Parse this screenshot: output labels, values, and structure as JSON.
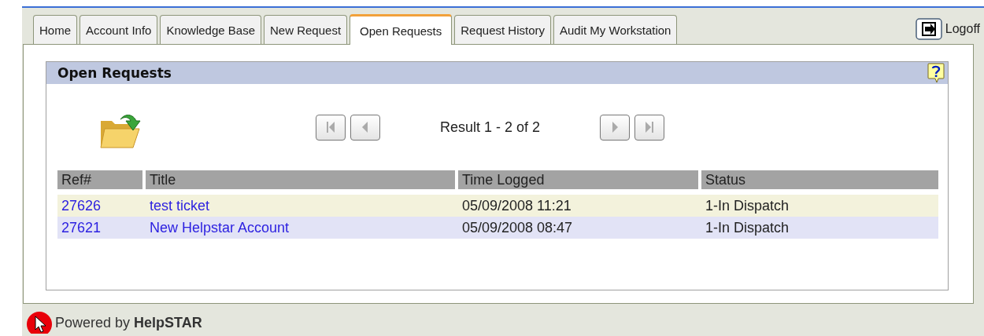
{
  "tabs": [
    {
      "label": "Home",
      "selected": false
    },
    {
      "label": "Account Info",
      "selected": false
    },
    {
      "label": "Knowledge Base",
      "selected": false
    },
    {
      "label": "New Request",
      "selected": false
    },
    {
      "label": "Open Requests",
      "selected": true
    },
    {
      "label": "Request History",
      "selected": false
    },
    {
      "label": "Audit My Workstation",
      "selected": false
    }
  ],
  "logoff": {
    "label": "Logoff"
  },
  "panel": {
    "title": "Open Requests"
  },
  "pager": {
    "result": "Result 1 - 2 of 2"
  },
  "table": {
    "columns": [
      "Ref#",
      "Title",
      "Time Logged",
      "Status"
    ],
    "rows": [
      {
        "ref": "27626",
        "title": "test ticket",
        "time": "05/09/2008 11:21",
        "status": "1-In Dispatch"
      },
      {
        "ref": "27621",
        "title": "New Helpstar Account",
        "time": "05/09/2008 08:47",
        "status": "1-In Dispatch"
      }
    ]
  },
  "footer": {
    "text": "Powered by **HelpSTAR**"
  }
}
